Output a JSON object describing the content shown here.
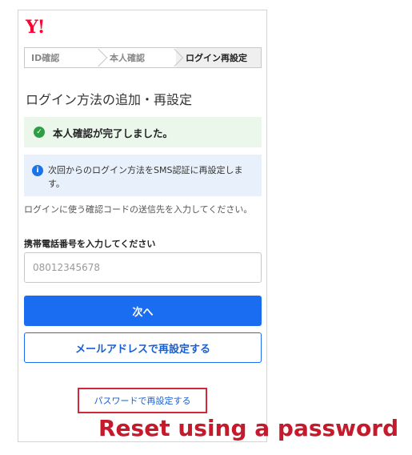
{
  "brand": {
    "logo": "Y!"
  },
  "steps": [
    {
      "label": "ID確認",
      "active": false
    },
    {
      "label": "本人確認",
      "active": false
    },
    {
      "label": "ログイン再設定",
      "active": true
    }
  ],
  "page_title": "ログイン方法の追加・再設定",
  "success_message": "本人確認が完了しました。",
  "info_message": "次回からのログイン方法をSMS認証に再設定します。",
  "description": "ログインに使う確認コードの送信先を入力してください。",
  "phone": {
    "label": "携帯電話番号を入力してください",
    "placeholder": "08012345678",
    "value": ""
  },
  "buttons": {
    "next": "次へ",
    "email_reset": "メールアドレスで再設定する"
  },
  "password_link": "パスワードで再設定する",
  "caption": "Reset using a password",
  "colors": {
    "brand": "#ff0033",
    "primary": "#1a6cf0",
    "success_bg": "#eaf7ea",
    "info_bg": "#e8f1fb",
    "highlight": "#d0293a"
  }
}
